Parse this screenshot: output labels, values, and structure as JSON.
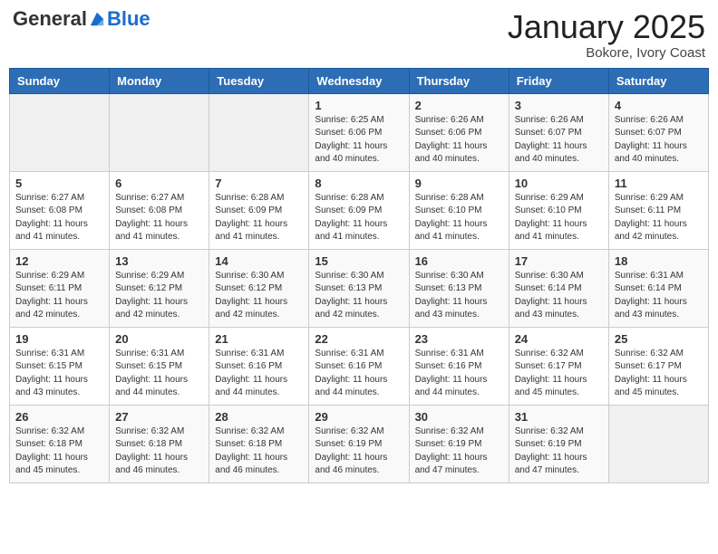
{
  "header": {
    "logo_general": "General",
    "logo_blue": "Blue",
    "month_title": "January 2025",
    "subtitle": "Bokore, Ivory Coast"
  },
  "days_of_week": [
    "Sunday",
    "Monday",
    "Tuesday",
    "Wednesday",
    "Thursday",
    "Friday",
    "Saturday"
  ],
  "weeks": [
    [
      {
        "day": "",
        "info": ""
      },
      {
        "day": "",
        "info": ""
      },
      {
        "day": "",
        "info": ""
      },
      {
        "day": "1",
        "info": "Sunrise: 6:25 AM\nSunset: 6:06 PM\nDaylight: 11 hours and 40 minutes."
      },
      {
        "day": "2",
        "info": "Sunrise: 6:26 AM\nSunset: 6:06 PM\nDaylight: 11 hours and 40 minutes."
      },
      {
        "day": "3",
        "info": "Sunrise: 6:26 AM\nSunset: 6:07 PM\nDaylight: 11 hours and 40 minutes."
      },
      {
        "day": "4",
        "info": "Sunrise: 6:26 AM\nSunset: 6:07 PM\nDaylight: 11 hours and 40 minutes."
      }
    ],
    [
      {
        "day": "5",
        "info": "Sunrise: 6:27 AM\nSunset: 6:08 PM\nDaylight: 11 hours and 41 minutes."
      },
      {
        "day": "6",
        "info": "Sunrise: 6:27 AM\nSunset: 6:08 PM\nDaylight: 11 hours and 41 minutes."
      },
      {
        "day": "7",
        "info": "Sunrise: 6:28 AM\nSunset: 6:09 PM\nDaylight: 11 hours and 41 minutes."
      },
      {
        "day": "8",
        "info": "Sunrise: 6:28 AM\nSunset: 6:09 PM\nDaylight: 11 hours and 41 minutes."
      },
      {
        "day": "9",
        "info": "Sunrise: 6:28 AM\nSunset: 6:10 PM\nDaylight: 11 hours and 41 minutes."
      },
      {
        "day": "10",
        "info": "Sunrise: 6:29 AM\nSunset: 6:10 PM\nDaylight: 11 hours and 41 minutes."
      },
      {
        "day": "11",
        "info": "Sunrise: 6:29 AM\nSunset: 6:11 PM\nDaylight: 11 hours and 42 minutes."
      }
    ],
    [
      {
        "day": "12",
        "info": "Sunrise: 6:29 AM\nSunset: 6:11 PM\nDaylight: 11 hours and 42 minutes."
      },
      {
        "day": "13",
        "info": "Sunrise: 6:29 AM\nSunset: 6:12 PM\nDaylight: 11 hours and 42 minutes."
      },
      {
        "day": "14",
        "info": "Sunrise: 6:30 AM\nSunset: 6:12 PM\nDaylight: 11 hours and 42 minutes."
      },
      {
        "day": "15",
        "info": "Sunrise: 6:30 AM\nSunset: 6:13 PM\nDaylight: 11 hours and 42 minutes."
      },
      {
        "day": "16",
        "info": "Sunrise: 6:30 AM\nSunset: 6:13 PM\nDaylight: 11 hours and 43 minutes."
      },
      {
        "day": "17",
        "info": "Sunrise: 6:30 AM\nSunset: 6:14 PM\nDaylight: 11 hours and 43 minutes."
      },
      {
        "day": "18",
        "info": "Sunrise: 6:31 AM\nSunset: 6:14 PM\nDaylight: 11 hours and 43 minutes."
      }
    ],
    [
      {
        "day": "19",
        "info": "Sunrise: 6:31 AM\nSunset: 6:15 PM\nDaylight: 11 hours and 43 minutes."
      },
      {
        "day": "20",
        "info": "Sunrise: 6:31 AM\nSunset: 6:15 PM\nDaylight: 11 hours and 44 minutes."
      },
      {
        "day": "21",
        "info": "Sunrise: 6:31 AM\nSunset: 6:16 PM\nDaylight: 11 hours and 44 minutes."
      },
      {
        "day": "22",
        "info": "Sunrise: 6:31 AM\nSunset: 6:16 PM\nDaylight: 11 hours and 44 minutes."
      },
      {
        "day": "23",
        "info": "Sunrise: 6:31 AM\nSunset: 6:16 PM\nDaylight: 11 hours and 44 minutes."
      },
      {
        "day": "24",
        "info": "Sunrise: 6:32 AM\nSunset: 6:17 PM\nDaylight: 11 hours and 45 minutes."
      },
      {
        "day": "25",
        "info": "Sunrise: 6:32 AM\nSunset: 6:17 PM\nDaylight: 11 hours and 45 minutes."
      }
    ],
    [
      {
        "day": "26",
        "info": "Sunrise: 6:32 AM\nSunset: 6:18 PM\nDaylight: 11 hours and 45 minutes."
      },
      {
        "day": "27",
        "info": "Sunrise: 6:32 AM\nSunset: 6:18 PM\nDaylight: 11 hours and 46 minutes."
      },
      {
        "day": "28",
        "info": "Sunrise: 6:32 AM\nSunset: 6:18 PM\nDaylight: 11 hours and 46 minutes."
      },
      {
        "day": "29",
        "info": "Sunrise: 6:32 AM\nSunset: 6:19 PM\nDaylight: 11 hours and 46 minutes."
      },
      {
        "day": "30",
        "info": "Sunrise: 6:32 AM\nSunset: 6:19 PM\nDaylight: 11 hours and 47 minutes."
      },
      {
        "day": "31",
        "info": "Sunrise: 6:32 AM\nSunset: 6:19 PM\nDaylight: 11 hours and 47 minutes."
      },
      {
        "day": "",
        "info": ""
      }
    ]
  ]
}
